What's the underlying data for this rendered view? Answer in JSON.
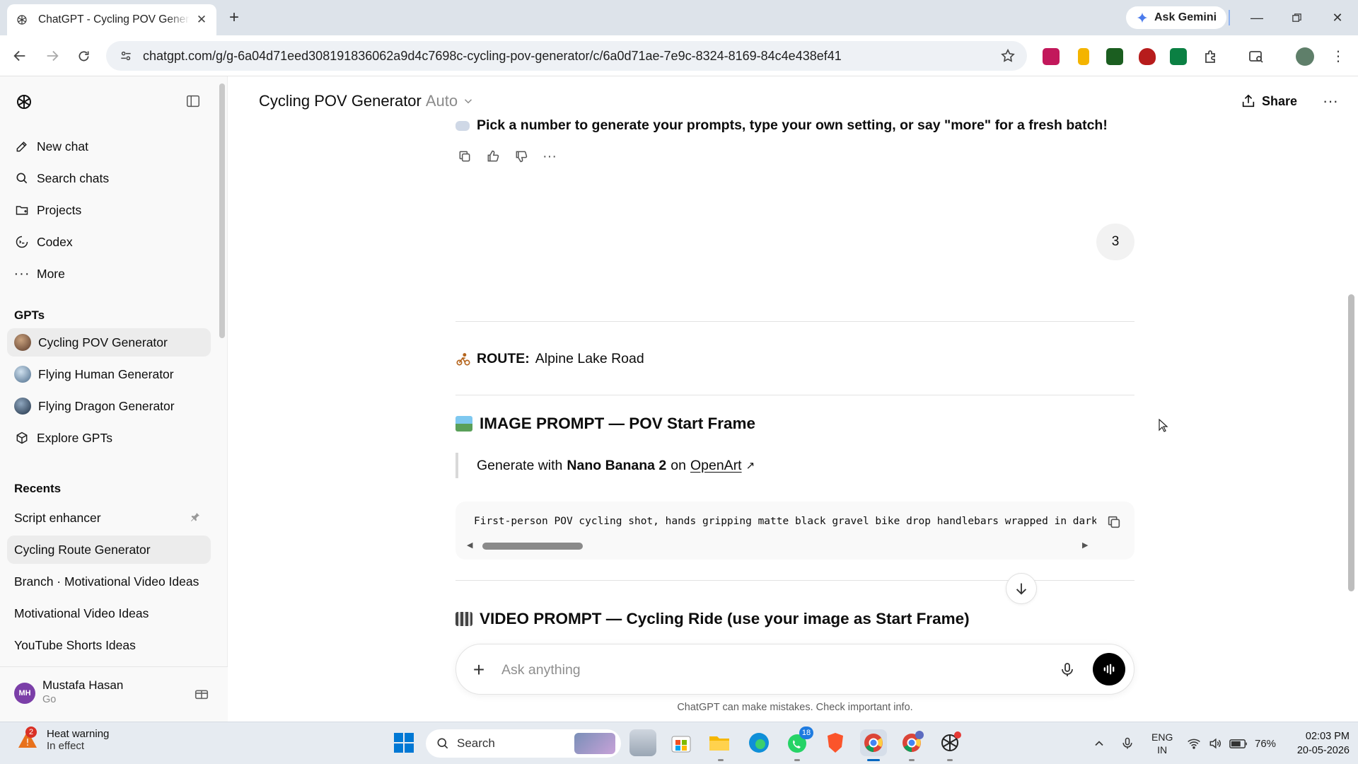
{
  "browser": {
    "tab_title": "ChatGPT - Cycling POV Generator",
    "url": "chatgpt.com/g/g-6a04d71eed308191836062a9d4c7698c-cycling-pov-generator/c/6a0d71ae-7e9c-8324-8169-84c4e438ef41",
    "ask_gemini": "Ask Gemini"
  },
  "sidebar": {
    "nav": [
      {
        "label": "New chat",
        "icon": "edit-icon"
      },
      {
        "label": "Search chats",
        "icon": "search-icon"
      },
      {
        "label": "Projects",
        "icon": "folder-icon"
      },
      {
        "label": "Codex",
        "icon": "codex-icon"
      },
      {
        "label": "More",
        "icon": "more-dots-icon"
      }
    ],
    "gpts_heading": "GPTs",
    "gpts": [
      {
        "label": "Cycling POV Generator",
        "avatar_color": "#7a5a45"
      },
      {
        "label": "Flying Human Generator",
        "avatar_color": "#6f8aa3"
      },
      {
        "label": "Flying Dragon Generator",
        "avatar_color": "#3b5068"
      },
      {
        "label": "Explore GPTs",
        "icon": "cube-icon"
      }
    ],
    "recents_heading": "Recents",
    "recents": [
      {
        "label": "Script enhancer"
      },
      {
        "label": "Cycling Route Generator"
      },
      {
        "label": "Branch · Motivational Video Ideas"
      },
      {
        "label": "Motivational Video Ideas"
      },
      {
        "label": "YouTube Shorts Ideas"
      }
    ],
    "user": {
      "initials": "MH",
      "name": "Mustafa Hasan",
      "plan": "Go"
    }
  },
  "header": {
    "title": "Cycling POV Generator",
    "model": "Auto",
    "share_label": "Share"
  },
  "conversation": {
    "prev_line": "Pick a number to generate your prompts, type your own setting, or say \"more\" for a fresh batch!",
    "user_message": "3",
    "route_label": "ROUTE:",
    "route_value": "Alpine Lake Road",
    "image_heading": "IMAGE PROMPT — POV Start Frame",
    "generate_prefix": "Generate with",
    "generate_model": "Nano Banana 2",
    "generate_on": "on",
    "generate_link": "OpenArt",
    "code_text": "First-person POV cycling shot, hands gripping matte black gravel bike drop handlebars wrapped in dark ol:",
    "video_heading": "VIDEO PROMPT — Cycling Ride (use your image as Start Frame)"
  },
  "composer": {
    "placeholder": "Ask anything",
    "disclaimer": "ChatGPT can make mistakes. Check important info."
  },
  "taskbar": {
    "weather_title": "Heat warning",
    "weather_sub": "In effect",
    "weather_badge": "2",
    "search_label": "Search",
    "whatsapp_badge": "18",
    "lang_top": "ENG",
    "lang_bottom": "IN",
    "battery": "76%",
    "time": "02:03 PM",
    "date": "20-05-2026"
  }
}
